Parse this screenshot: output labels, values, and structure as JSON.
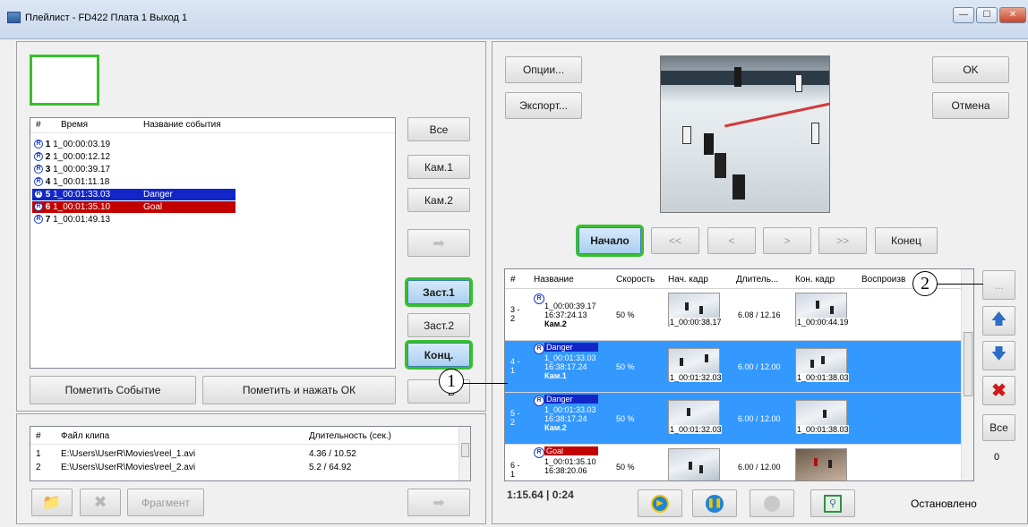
{
  "window": {
    "title": "Плейлист - FD422 Плата 1 Выход 1",
    "controls": [
      "—",
      "☐",
      "✕"
    ]
  },
  "events": {
    "headers": {
      "num": "#",
      "time": "Время",
      "name": "Название события"
    },
    "rows": [
      {
        "num": "1",
        "time": "1_00:00:03.19",
        "name": ""
      },
      {
        "num": "2",
        "time": "1_00:00:12.12",
        "name": ""
      },
      {
        "num": "3",
        "time": "1_00:00:39.17",
        "name": ""
      },
      {
        "num": "4",
        "time": "1_00:01:11.18",
        "name": ""
      },
      {
        "num": "5",
        "time": "1_00:01:33.03",
        "name": "Danger"
      },
      {
        "num": "6",
        "time": "1_00:01:35.10",
        "name": "Goal"
      },
      {
        "num": "7",
        "time": "1_00:01:49.13",
        "name": ""
      }
    ],
    "badge": "R"
  },
  "left_buttons": {
    "all": "Все",
    "cam1": "Кам.1",
    "cam2": "Кам.2",
    "zast1": "Заст.1",
    "zast2": "Заст.2",
    "konts": "Конц.",
    "mark_event": "Пометить Событие",
    "mark_ok": "Пометить и нажать ОК",
    "vse_partial": "В"
  },
  "clips": {
    "headers": {
      "num": "#",
      "file": "Файл клипа",
      "duration": "Длительность (сек.)"
    },
    "rows": [
      {
        "num": "1",
        "file": "E:\\Users\\UserR\\Movies\\reel_1.avi",
        "duration": "4.36 / 10.52"
      },
      {
        "num": "2",
        "file": "E:\\Users\\UserR\\Movies\\reel_2.avi",
        "duration": "5.2 / 64.92"
      }
    ],
    "fragment": "Фрагмент"
  },
  "right": {
    "options": "Опции...",
    "export": "Экспорт...",
    "ok": "OK",
    "cancel": "Отмена",
    "start": "Начало",
    "prev2": "<<",
    "prev1": "<",
    "next1": ">",
    "next2": ">>",
    "end": "Конец",
    "more": "...",
    "all": "Все",
    "count": "0",
    "time_readout": "1:15.64 | 0:24",
    "status": "Остановлено"
  },
  "grid": {
    "headers": {
      "num": "#",
      "name": "Название",
      "speed": "Скорость",
      "start": "Нач. кадр",
      "duration": "Длитель...",
      "end": "Кон. кадр",
      "play": "Воспроизв"
    },
    "rows": [
      {
        "num": "3 -\n2",
        "tag": "",
        "t1": "1_00:00:39.17",
        "t2": "16:37:24.13",
        "cam": "Кам.2",
        "speed": "50 %",
        "start_tc": "1_00:00:38.17",
        "dur": "6.08 / 12.16",
        "end_tc": "1_00:00:44.19",
        "selected": false
      },
      {
        "num": "4 -\n1",
        "tag": "Danger",
        "t1": "1_00:01:33.03",
        "t2": "16:38:17.24",
        "cam": "Кам.1",
        "speed": "50 %",
        "start_tc": "1_00:01:32.03",
        "dur": "6.00 / 12.00",
        "end_tc": "1_00:01:38.03",
        "selected": true
      },
      {
        "num": "5 -\n2",
        "tag": "Danger",
        "t1": "1_00:01:33.03",
        "t2": "16:38:17.24",
        "cam": "Кам.2",
        "speed": "50 %",
        "start_tc": "1_00:01:32.03",
        "dur": "6.00 / 12.00",
        "end_tc": "1_00:01:38.03",
        "selected": true
      },
      {
        "num": "6 -\n1",
        "tag": "Goal",
        "t1": "1_00:01:35.10",
        "t2": "16:38:20.06",
        "cam": "Кам.1",
        "speed": "50 %",
        "start_tc": "",
        "dur": "6.00 / 12.00",
        "end_tc": "",
        "selected": false
      }
    ]
  },
  "callouts": {
    "one": "1",
    "two": "2"
  },
  "colors": {
    "highlight_green": "#37c02c",
    "selection_blue": "#3399ff",
    "tag_danger": "#1226c8",
    "tag_goal": "#c30000"
  }
}
